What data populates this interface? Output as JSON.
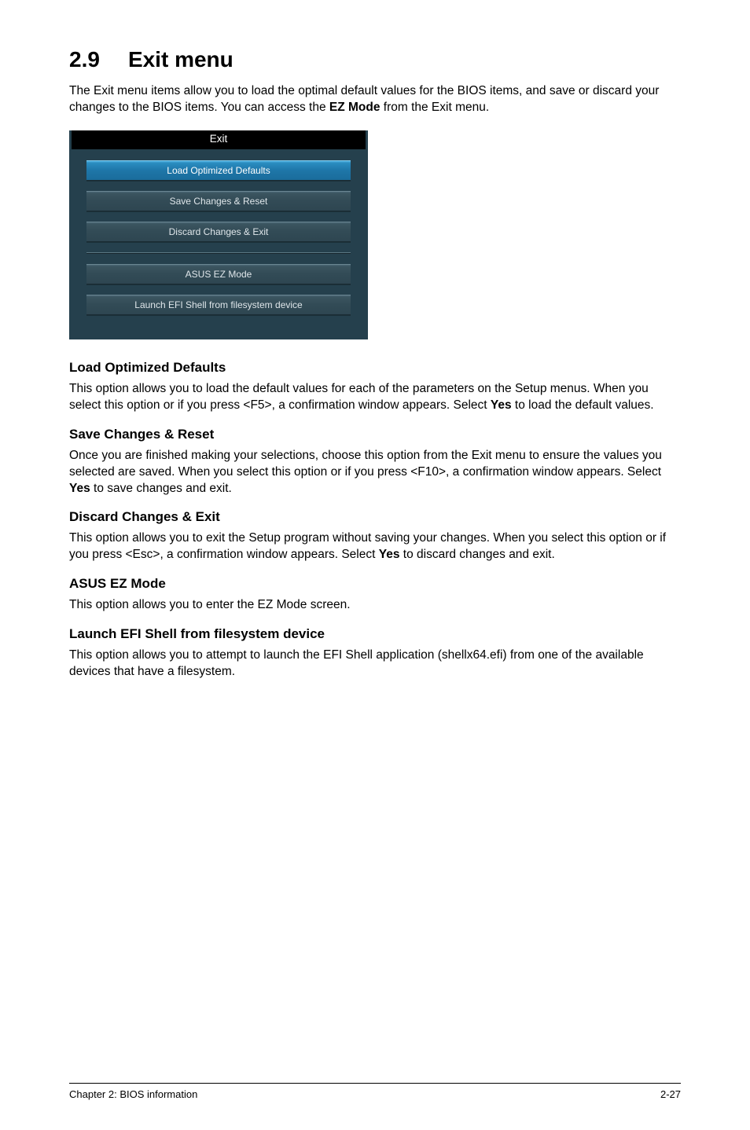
{
  "section": {
    "number": "2.9",
    "title": "Exit menu"
  },
  "intro": {
    "part1": "The Exit menu items allow you to load the optimal default values for the BIOS items, and save or discard your changes to the BIOS items. You can access the ",
    "bold": "EZ Mode",
    "part2": " from the Exit menu."
  },
  "bios": {
    "header": "Exit",
    "buttons": {
      "load_defaults": "Load Optimized Defaults",
      "save_reset": "Save Changes & Reset",
      "discard_exit": "Discard Changes & Exit",
      "ez_mode": "ASUS EZ Mode",
      "launch_efi": "Launch EFI Shell from filesystem device"
    }
  },
  "subsections": {
    "load_defaults": {
      "heading": "Load Optimized Defaults",
      "text_a": "This option allows you to load the default values for each of the parameters on the Setup menus. When you select this option or if you press <F5>, a confirmation window appears. Select ",
      "bold": "Yes",
      "text_b": " to load the default values."
    },
    "save_reset": {
      "heading": "Save Changes & Reset",
      "text_a": "Once you are finished making your selections, choose this option from the Exit menu to ensure the values you selected are saved. When you select this option or if you press <F10>, a confirmation window appears. Select ",
      "bold": "Yes",
      "text_b": " to save changes and exit."
    },
    "discard_exit": {
      "heading": "Discard Changes & Exit",
      "text_a": "This option allows you to exit the Setup program without saving your changes. When you select this option or if you press <Esc>, a confirmation window appears. Select ",
      "bold": "Yes",
      "text_b": " to discard changes and exit."
    },
    "ez_mode": {
      "heading": "ASUS EZ Mode",
      "text": "This option allows you to enter the EZ Mode screen."
    },
    "launch_efi": {
      "heading": "Launch EFI Shell from filesystem device",
      "text": "This option allows you to attempt to launch the EFI Shell application (shellx64.efi) from one of the available devices that have a filesystem."
    }
  },
  "footer": {
    "left": "Chapter 2: BIOS information",
    "right": "2-27"
  }
}
